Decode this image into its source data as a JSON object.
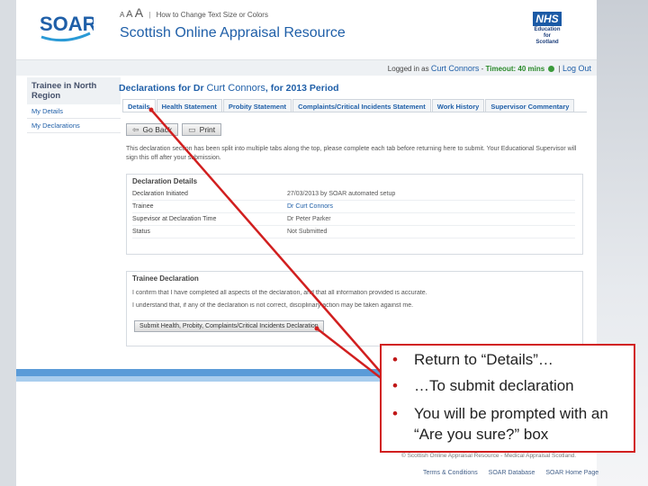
{
  "header": {
    "logo_text": "SOAR",
    "text_size_a_small": "A",
    "text_size_a_medium": "A",
    "text_size_a_large": "A",
    "text_size_link": "How to Change Text Size or Colors",
    "site_title": "Scottish Online Appraisal Resource",
    "nhs_logo": "NHS",
    "nhs_sub1": "Education",
    "nhs_sub2": "for",
    "nhs_sub3": "Scotland"
  },
  "login_bar": {
    "logged_in_as": "Logged in as",
    "user": "Curt Connors",
    "dash": "-",
    "timeout": "Timeout: 40 mins",
    "separator": "|",
    "logout": "Log Out"
  },
  "sidebar": {
    "region": "Trainee in North Region",
    "items": [
      {
        "label": "My Details"
      },
      {
        "label": "My Declarations"
      }
    ]
  },
  "main": {
    "title_prefix": "Declarations for Dr",
    "title_name": "Curt Connors",
    "title_suffix": ", for 2013 Period",
    "tabs": [
      {
        "label": "Details"
      },
      {
        "label": "Health Statement"
      },
      {
        "label": "Probity Statement"
      },
      {
        "label": "Complaints/Critical Incidents Statement"
      },
      {
        "label": "Work History"
      },
      {
        "label": "Supervisor Commentary"
      }
    ],
    "go_back_label": "Go Back",
    "print_label": "Print",
    "info_text": "This declaration section has been split into multiple tabs along the top, please complete each tab before returning here to submit. Your Educational Supervisor will sign this off after your submission.",
    "details_box": {
      "title": "Declaration Details",
      "rows": [
        {
          "key": "Declaration Initiated",
          "value": "27/03/2013 by SOAR automated setup"
        },
        {
          "key": "Trainee",
          "value": "Dr Curt Connors"
        },
        {
          "key": "Supevisor at Declaration Time",
          "value": "Dr Peter Parker"
        },
        {
          "key": "Status",
          "value": "Not Submitted"
        }
      ]
    },
    "trainee_box": {
      "title": "Trainee Declaration",
      "line1": "I confirm that I have completed all aspects of the declaration, and that all information provided is accurate.",
      "line2": "I understand that, if any of the declaration is not correct, disciplinary action may be taken against me.",
      "submit_label": "Submit Health, Probity, Complaints/Critical Incidents Declaration"
    }
  },
  "footer": {
    "copyright": "© Scottish Online Appraisal Resource - Medical Appraisal Scotland.",
    "links": [
      "Terms & Conditions",
      "SOAR Database",
      "SOAR Home Page"
    ]
  },
  "callout": {
    "bullets": [
      {
        "text": "Return to “Details”…"
      },
      {
        "text": "…To submit declaration"
      },
      {
        "text": "You will be prompted with an “Are you sure?” box"
      }
    ],
    "bullet_glyph": "•"
  },
  "colors": {
    "accent": "#1f5fa8",
    "annotation": "#d11f1f"
  }
}
